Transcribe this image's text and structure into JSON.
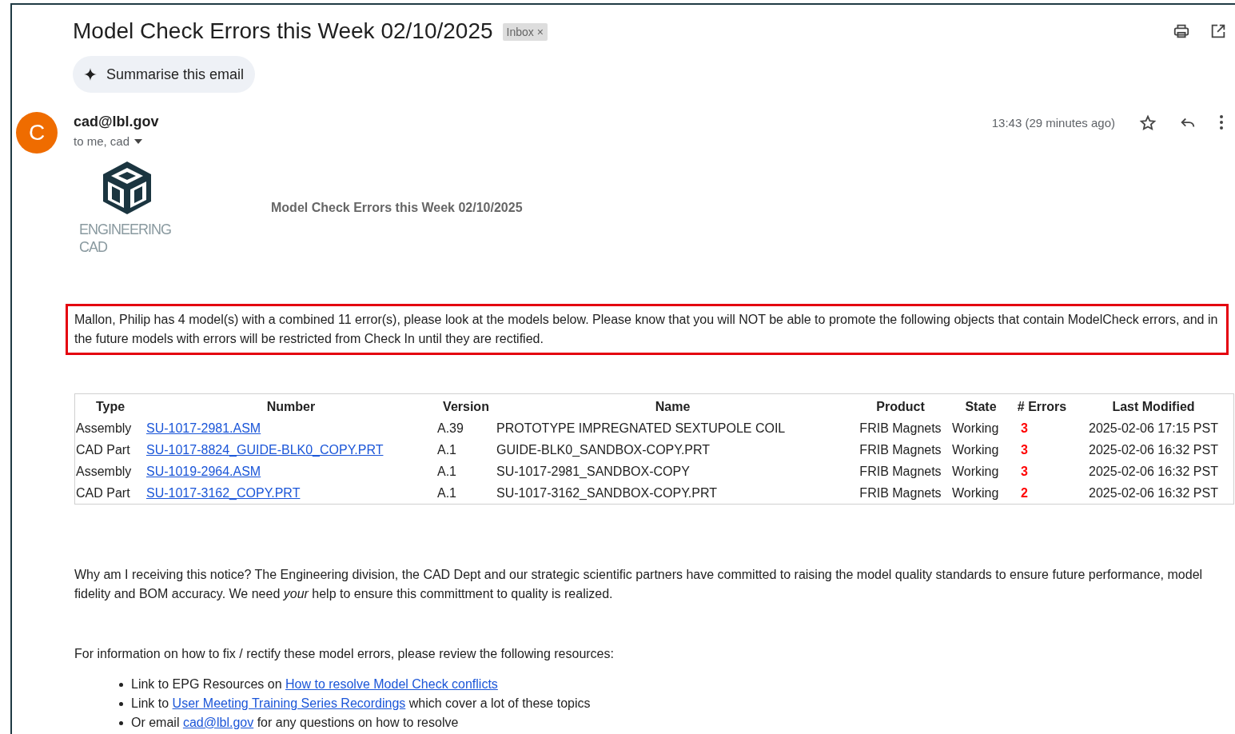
{
  "subject": "Model Check Errors this Week 02/10/2025",
  "label_chip": {
    "text": "Inbox",
    "close": "×"
  },
  "summarise_button": "Summarise this email",
  "sender": {
    "avatar": "C",
    "email": "cad@lbl.gov",
    "recipients": "to me, cad",
    "time": "13:43 (29 minutes ago)",
    "starred": false
  },
  "logo": {
    "line_1": "ENGINEERING",
    "line_2": "CAD"
  },
  "body_title": "Model Check Errors this Week 02/10/2025",
  "notice": "Mallon, Philip has 4 model(s) with a combined 11 error(s), please look at the models below. Please know that you will NOT be able to promote the following objects that contain ModelCheck errors, and in the future models with errors will be restricted from Check In until they are rectified.",
  "table": {
    "columns": [
      "Type",
      "Number",
      "Version",
      "Name",
      "Product",
      "State",
      "# Errors",
      "Last Modified"
    ],
    "rows": [
      [
        "Assembly",
        "SU-1017-2981.ASM",
        "A.39",
        "PROTOTYPE IMPREGNATED SEXTUPOLE COIL",
        "FRIB Magnets",
        "Working",
        "3",
        "2025-02-06 17:15 PST"
      ],
      [
        "CAD Part",
        "SU-1017-8824_GUIDE-BLK0_COPY.PRT",
        "A.1",
        "GUIDE-BLK0_SANDBOX-COPY.PRT",
        "FRIB Magnets",
        "Working",
        "3",
        "2025-02-06 16:32 PST"
      ],
      [
        "Assembly",
        "SU-1019-2964.ASM",
        "A.1",
        "SU-1017-2981_SANDBOX-COPY",
        "FRIB Magnets",
        "Working",
        "3",
        "2025-02-06 16:32 PST"
      ],
      [
        "CAD Part",
        "SU-1017-3162_COPY.PRT",
        "A.1",
        "SU-1017-3162_SANDBOX-COPY.PRT",
        "FRIB Magnets",
        "Working",
        "2",
        "2025-02-06 16:32 PST"
      ]
    ]
  },
  "why_paragraph": "Why am I receiving this notice? The Engineering division, the CAD Dept and our strategic scientific partners have committed to raising the model quality standards to ensure future performance, model fidelity and BOM accuracy. We need *your* help to ensure this committment to quality is realized.",
  "resources_intro": "For information on how to fix / rectify these model errors, please review the following resources:",
  "resources": [
    {
      "before": "Link to EPG Resources on ",
      "link": "How to resolve Model Check conflicts"
    },
    {
      "before": "Link to ",
      "link": "User Meeting Training Series Recordings",
      "after": " which cover a lot of these topics"
    },
    {
      "before": "Or email ",
      "link": "cad@lbl.gov",
      "after": " for any questions on how to resolve"
    }
  ]
}
